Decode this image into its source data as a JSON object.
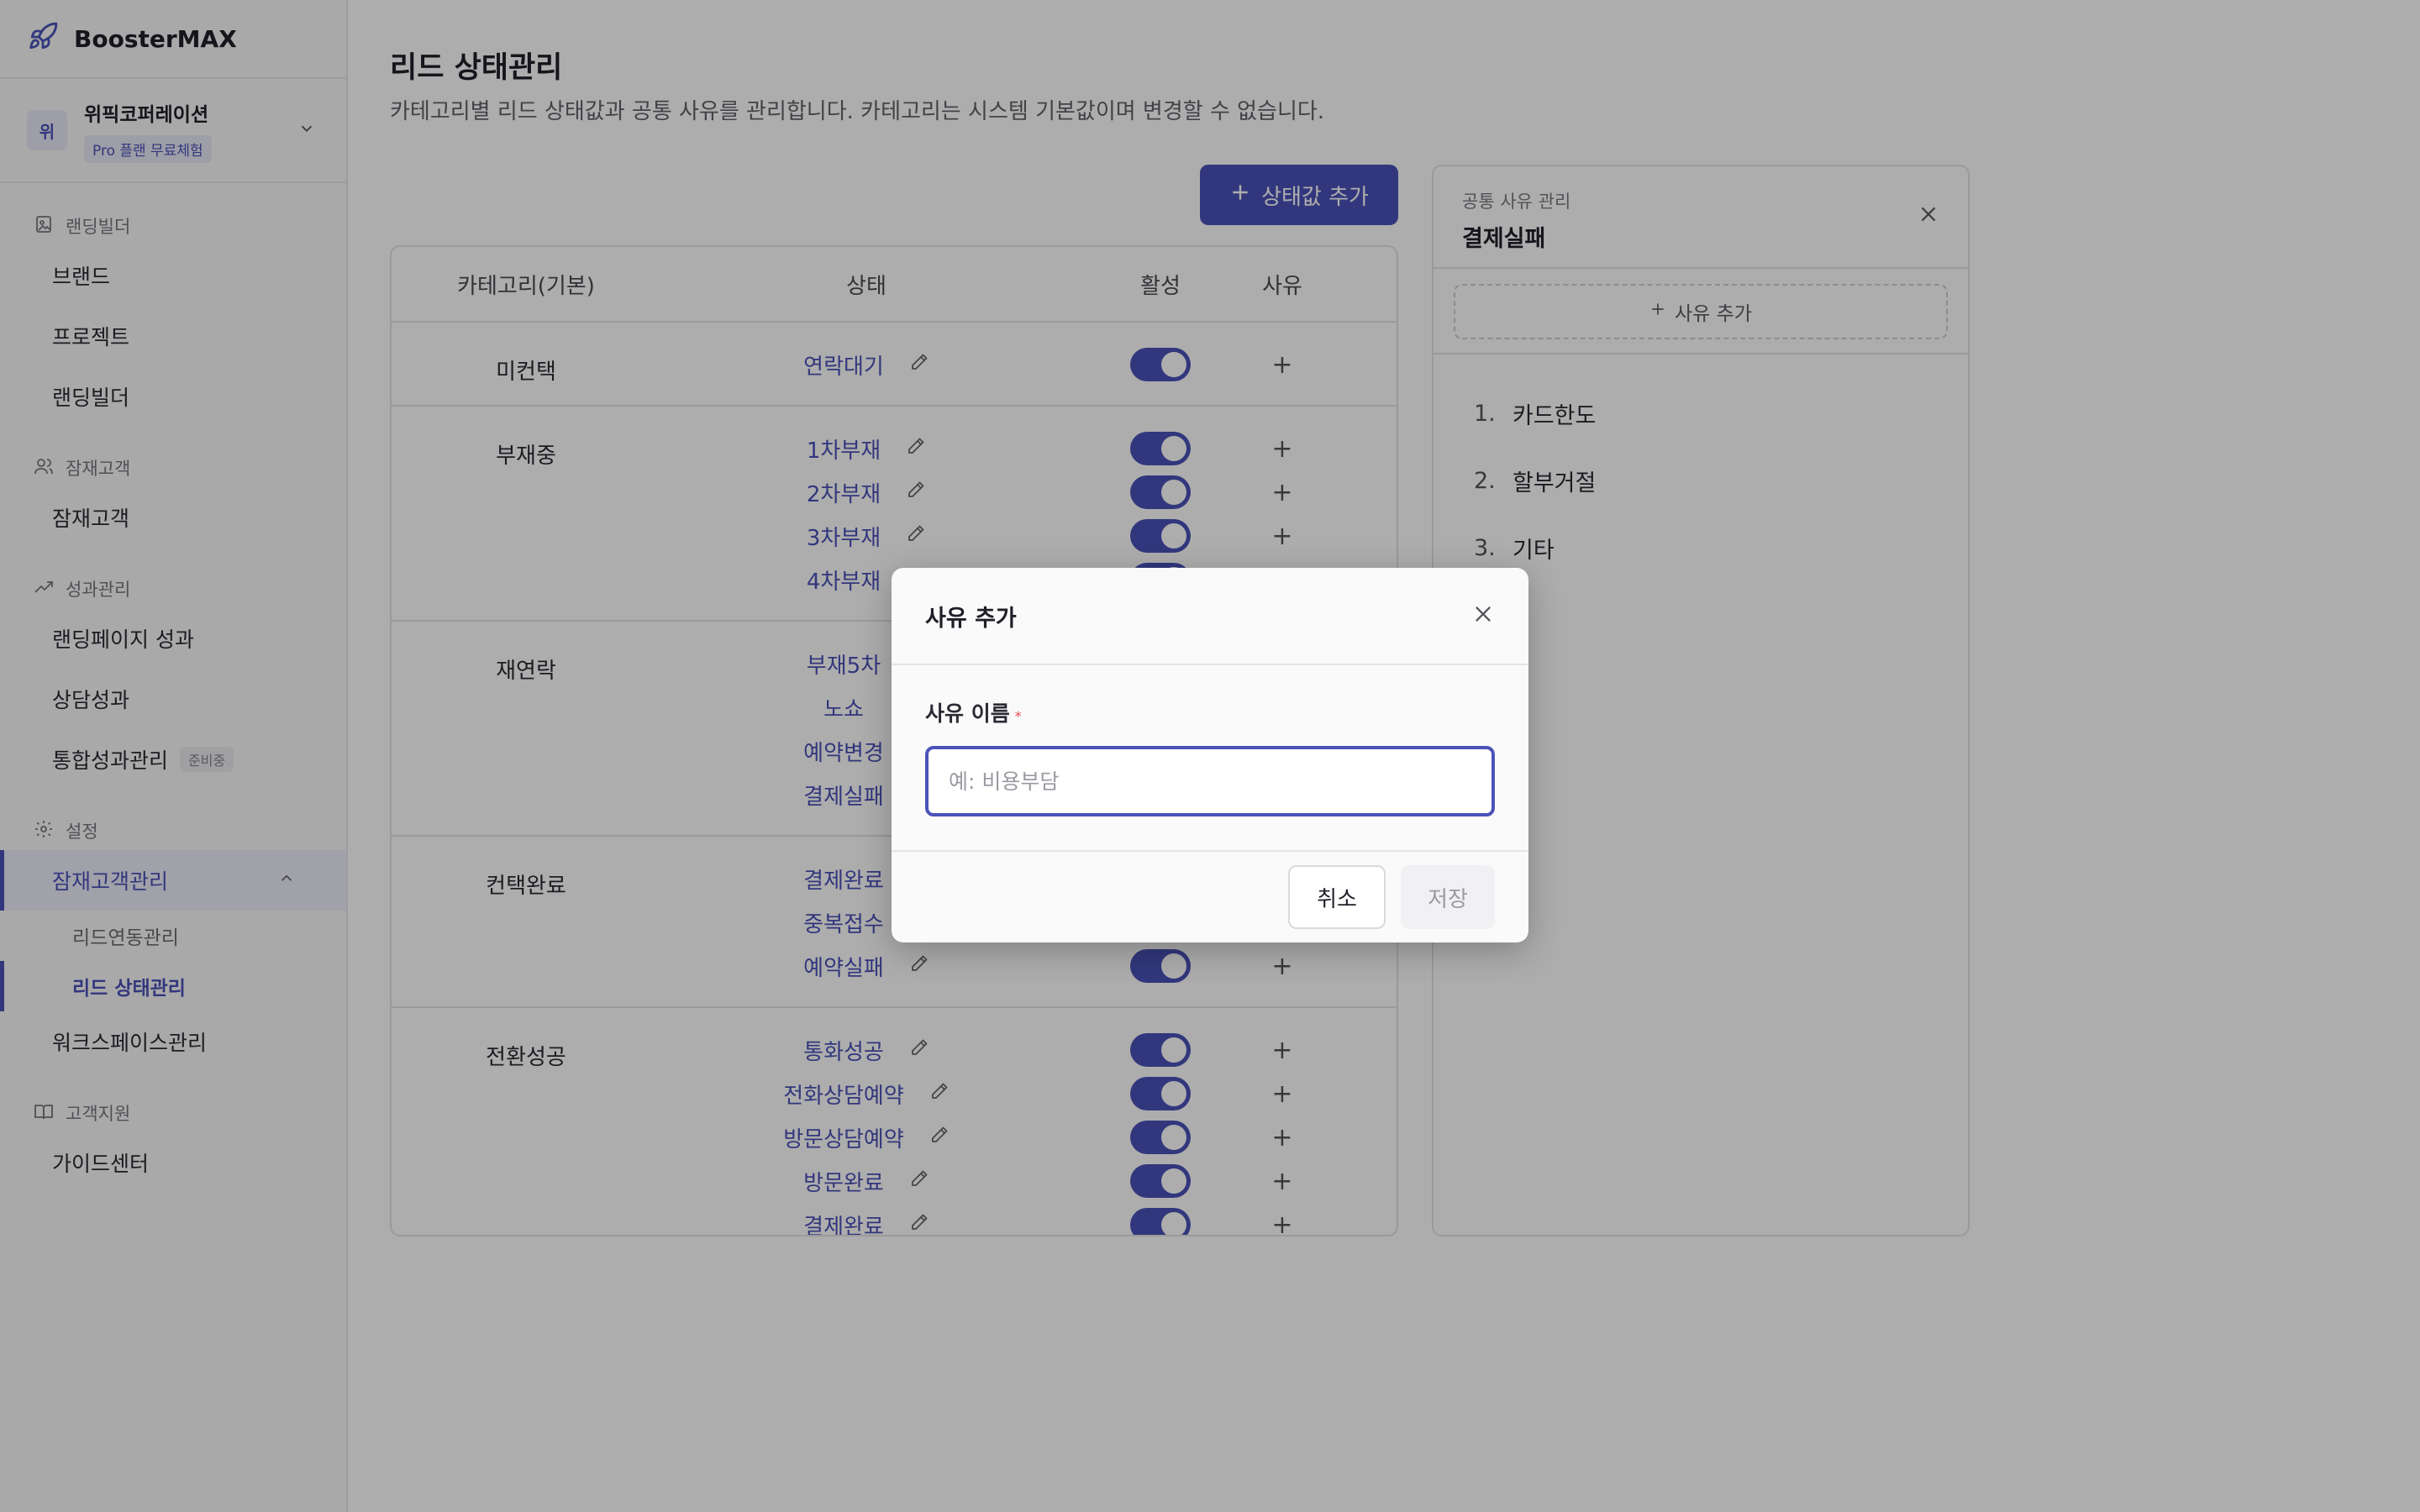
{
  "brand": {
    "name": "BoosterMAX",
    "icon": "rocket-icon"
  },
  "workspace": {
    "avatar": "위",
    "name": "위픽코퍼레이션",
    "plan": "Pro 플랜 무료체험"
  },
  "nav": {
    "landing_builder": {
      "section": "랜딩빌더",
      "items": [
        "브랜드",
        "프로젝트",
        "랜딩빌더"
      ]
    },
    "prospects": {
      "section": "잠재고객",
      "items": [
        "잠재고객"
      ]
    },
    "performance": {
      "section": "성과관리",
      "items": [
        "랜딩페이지 성과",
        "상담성과",
        "통합성과관리"
      ],
      "soon_badge": "준비중"
    },
    "settings": {
      "section": "설정",
      "active_item": "잠재고객관리",
      "sub_items": [
        "리드연동관리",
        "리드 상태관리"
      ],
      "workspace_item": "워크스페이스관리"
    },
    "support": {
      "section": "고객지원",
      "items": [
        "가이드센터"
      ]
    }
  },
  "page": {
    "title": "리드 상태관리",
    "description": "카테고리별 리드 상태값과 공통 사유를 관리합니다. 카테고리는 시스템 기본값이며 변경할 수 없습니다.",
    "add_status_label": "상태값 추가"
  },
  "table": {
    "headers": {
      "category": "카테고리(기본)",
      "status": "상태",
      "active": "활성",
      "reason": "사유"
    },
    "groups": [
      {
        "category": "미컨택",
        "statuses": [
          "연락대기"
        ]
      },
      {
        "category": "부재중",
        "statuses": [
          "1차부재",
          "2차부재",
          "3차부재",
          "4차부재"
        ]
      },
      {
        "category": "재연락",
        "statuses": [
          "부재5차",
          "노쇼",
          "예약변경",
          "결제실패"
        ]
      },
      {
        "category": "컨택완료",
        "statuses": [
          "결제완료",
          "중복접수",
          "예약실패"
        ]
      },
      {
        "category": "전환성공",
        "statuses": [
          "통화성공",
          "전화상담예약",
          "방문상담예약",
          "방문완료",
          "결제완료"
        ]
      }
    ],
    "add_reason_symbol": "+"
  },
  "reason_panel": {
    "subtitle": "공통 사유 관리",
    "title": "결제실패",
    "add_label": "사유 추가",
    "items": [
      {
        "num": "1.",
        "label": "카드한도"
      },
      {
        "num": "2.",
        "label": "할부거절"
      },
      {
        "num": "3.",
        "label": "기타"
      }
    ]
  },
  "modal": {
    "title": "사유 추가",
    "field_label": "사유 이름",
    "required_mark": "*",
    "placeholder": "예: 비용부담",
    "value": "",
    "cancel_label": "취소",
    "save_label": "저장"
  },
  "colors": {
    "accent": "#4b52b8",
    "required": "#e5484d"
  }
}
